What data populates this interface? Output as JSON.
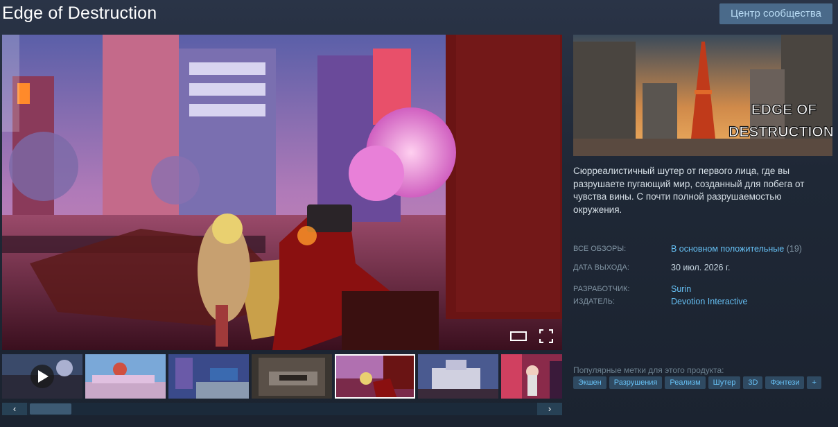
{
  "page": {
    "title": "Edge of Destruction",
    "community_button": "Центр сообщества"
  },
  "media": {
    "thumbnail_count": 7,
    "selected_thumbnail": 5,
    "first_thumbnail_is_video": true,
    "scroll_left_icon": "chevron-left-icon",
    "scroll_right_icon": "chevron-right-icon",
    "controls": [
      "widescreen-icon",
      "fullscreen-icon",
      "play-icon"
    ]
  },
  "header_art": {
    "logo_text": "EDGE OF DESTRUCTION"
  },
  "description": "Сюрреалистичный шутер от первого лица, где вы разрушаете пугающий мир, созданный для побега от чувства вины. С почти полной разрушаемостью окружения.",
  "info": {
    "reviews_label": "ВСЕ ОБЗОРЫ:",
    "reviews_value": "В основном положительные",
    "reviews_count": "(19)",
    "release_label": "ДАТА ВЫХОДА:",
    "release_value": "30 июл. 2026 г.",
    "developer_label": "РАЗРАБОТЧИК:",
    "developer_value": "Surin",
    "publisher_label": "ИЗДАТЕЛЬ:",
    "publisher_value": "Devotion Interactive"
  },
  "tags": {
    "label": "Популярные метки для этого продукта:",
    "items": [
      "Экшен",
      "Разрушения",
      "Реализм",
      "Шутер",
      "3D",
      "Фэнтези",
      "+"
    ]
  },
  "colors": {
    "link": "#66c0f4",
    "tag_bg": "#2f4a62",
    "button_bg": "#4a6a8a"
  }
}
